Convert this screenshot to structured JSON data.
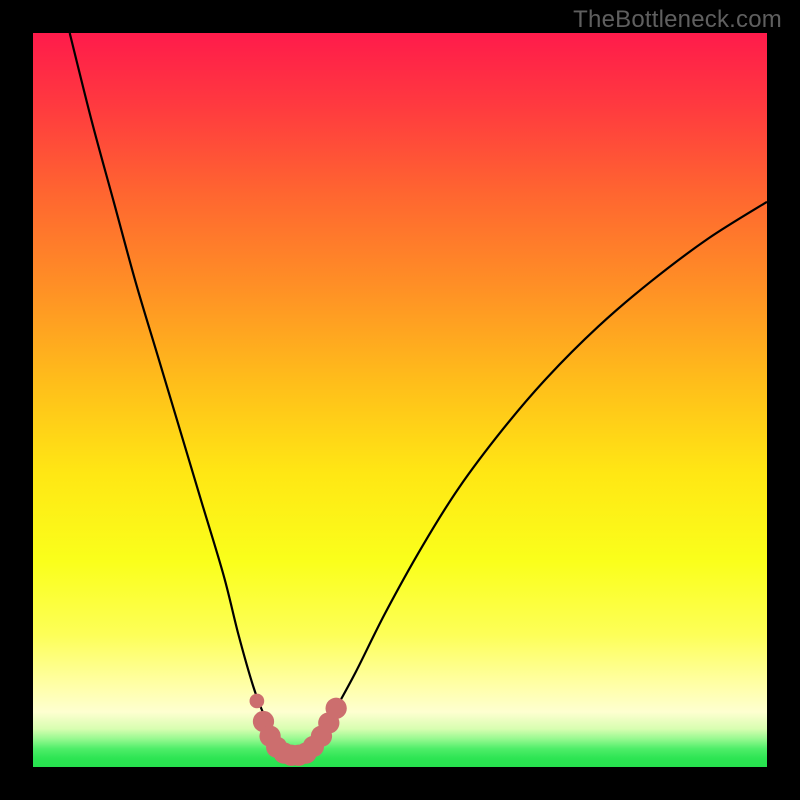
{
  "watermark": {
    "text": "TheBottleneck.com"
  },
  "colors": {
    "frame": "#000000",
    "curve": "#000000",
    "marker": "#cc6e6e",
    "green": "#2fe651"
  },
  "gradient_stops": [
    {
      "offset": 0.0,
      "color": "#ff1b4b"
    },
    {
      "offset": 0.1,
      "color": "#ff3a3f"
    },
    {
      "offset": 0.22,
      "color": "#ff6630"
    },
    {
      "offset": 0.35,
      "color": "#ff9125"
    },
    {
      "offset": 0.48,
      "color": "#ffbf1a"
    },
    {
      "offset": 0.6,
      "color": "#ffe714"
    },
    {
      "offset": 0.72,
      "color": "#faff1b"
    },
    {
      "offset": 0.82,
      "color": "#fdff58"
    },
    {
      "offset": 0.885,
      "color": "#ffffa3"
    },
    {
      "offset": 0.925,
      "color": "#feffd0"
    },
    {
      "offset": 0.948,
      "color": "#d8feb1"
    },
    {
      "offset": 0.962,
      "color": "#95f98f"
    },
    {
      "offset": 0.975,
      "color": "#4fee69"
    },
    {
      "offset": 0.988,
      "color": "#2de553"
    },
    {
      "offset": 1.0,
      "color": "#26e24e"
    }
  ],
  "chart_data": {
    "type": "line",
    "title": "",
    "xlabel": "",
    "ylabel": "",
    "xlim": [
      0,
      100
    ],
    "ylim": [
      0,
      100
    ],
    "series": [
      {
        "name": "bottleneck-curve",
        "x": [
          5,
          8,
          11,
          14,
          17,
          20,
          23,
          26,
          28,
          30,
          31.5,
          33,
          34.5,
          36,
          37.5,
          39,
          41,
          44,
          48,
          53,
          58,
          64,
          70,
          77,
          84,
          92,
          100
        ],
        "y": [
          100,
          88,
          77,
          66,
          56,
          46,
          36,
          26,
          18,
          11,
          7,
          4,
          2.2,
          1.6,
          2.2,
          4,
          7.5,
          13,
          21,
          30,
          38,
          46,
          53,
          60,
          66,
          72,
          77
        ]
      }
    ],
    "markers": {
      "name": "highlighted-band",
      "points": [
        {
          "x": 30.5,
          "y": 9.0,
          "r": 1.0
        },
        {
          "x": 31.4,
          "y": 6.2,
          "r": 1.45
        },
        {
          "x": 32.3,
          "y": 4.2,
          "r": 1.45
        },
        {
          "x": 33.2,
          "y": 2.7,
          "r": 1.45
        },
        {
          "x": 34.2,
          "y": 1.9,
          "r": 1.45
        },
        {
          "x": 35.2,
          "y": 1.6,
          "r": 1.45
        },
        {
          "x": 36.2,
          "y": 1.6,
          "r": 1.45
        },
        {
          "x": 37.2,
          "y": 1.9,
          "r": 1.45
        },
        {
          "x": 38.2,
          "y": 2.8,
          "r": 1.45
        },
        {
          "x": 39.3,
          "y": 4.2,
          "r": 1.45
        },
        {
          "x": 40.3,
          "y": 6.0,
          "r": 1.45
        },
        {
          "x": 41.3,
          "y": 8.0,
          "r": 1.45
        }
      ]
    }
  }
}
